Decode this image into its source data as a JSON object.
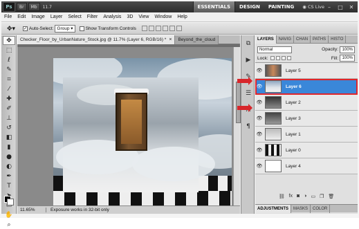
{
  "app": {
    "logo": "Ps",
    "appbar_buttons": [
      "Br",
      "Mb"
    ],
    "zoom": "11.7",
    "workspaces": [
      "ESSENTIALS",
      "DESIGN",
      "PAINTING"
    ],
    "cslive": "CS Live"
  },
  "menu": [
    "File",
    "Edit",
    "Image",
    "Layer",
    "Select",
    "Filter",
    "Analysis",
    "3D",
    "View",
    "Window",
    "Help"
  ],
  "options": {
    "auto_select_label": "Auto-Select:",
    "auto_select_value": "Group",
    "transform_label": "Show Transform Controls"
  },
  "doc": {
    "tabs": [
      {
        "label": "Checker_Floor_by_UrbanNature_Stock.jpg @ 11.7% (Layer 6, RGB/16) *"
      },
      {
        "label": "Beyond_the_cloud"
      }
    ],
    "close_glyph": "×",
    "status_zoom": "11.65%",
    "status_message": "Exposure works in 32-bit only"
  },
  "layers_panel": {
    "tabs": [
      "LAYERS",
      "NAVIG",
      "CHAN",
      "PATHS",
      "HISTO"
    ],
    "blend_mode": "Normal",
    "opacity_label": "Opacity:",
    "opacity_value": "100%",
    "lock_label": "Lock:",
    "fill_label": "Fill:",
    "fill_value": "100%",
    "layers": [
      {
        "name": "Layer 5",
        "selected": false
      },
      {
        "name": "Layer 6",
        "selected": true
      },
      {
        "name": "Layer 2",
        "selected": false
      },
      {
        "name": "Layer 3",
        "selected": false
      },
      {
        "name": "Layer 1",
        "selected": false
      },
      {
        "name": "Layer 0",
        "selected": false
      },
      {
        "name": "Layer 4",
        "selected": false
      }
    ],
    "bottom_tabs": [
      "ADJUSTMENTS",
      "MASKS",
      "COLOR"
    ]
  },
  "colors": {
    "selected_layer": "#3a87d9",
    "highlight_border": "#e0252a",
    "arrow": "#d8262b"
  }
}
